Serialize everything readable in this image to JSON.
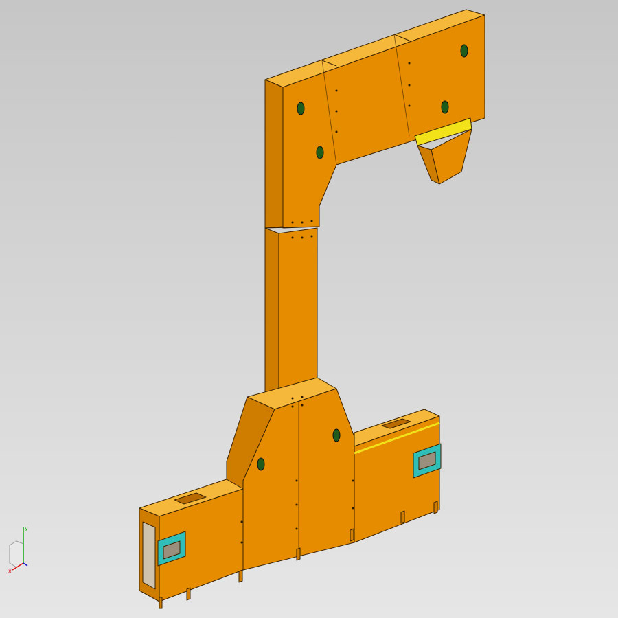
{
  "viewport": {
    "background_top": "#c6c6c6",
    "background_bottom": "#e6e6e6"
  },
  "model": {
    "body_color_front": "#e58c00",
    "body_color_top": "#f6b83a",
    "body_color_side": "#cf7d00",
    "outline_color": "#3a2200",
    "band_color": "#f2e21a",
    "tensioner_color": "#2fbfb8",
    "bearing_color": "#1f5c1c",
    "window_color": "#cfc3ae"
  },
  "triad": {
    "axes": [
      "x",
      "y",
      "z"
    ],
    "x_color": "#d11",
    "y_color": "#1a1",
    "z_color": "#11c"
  }
}
